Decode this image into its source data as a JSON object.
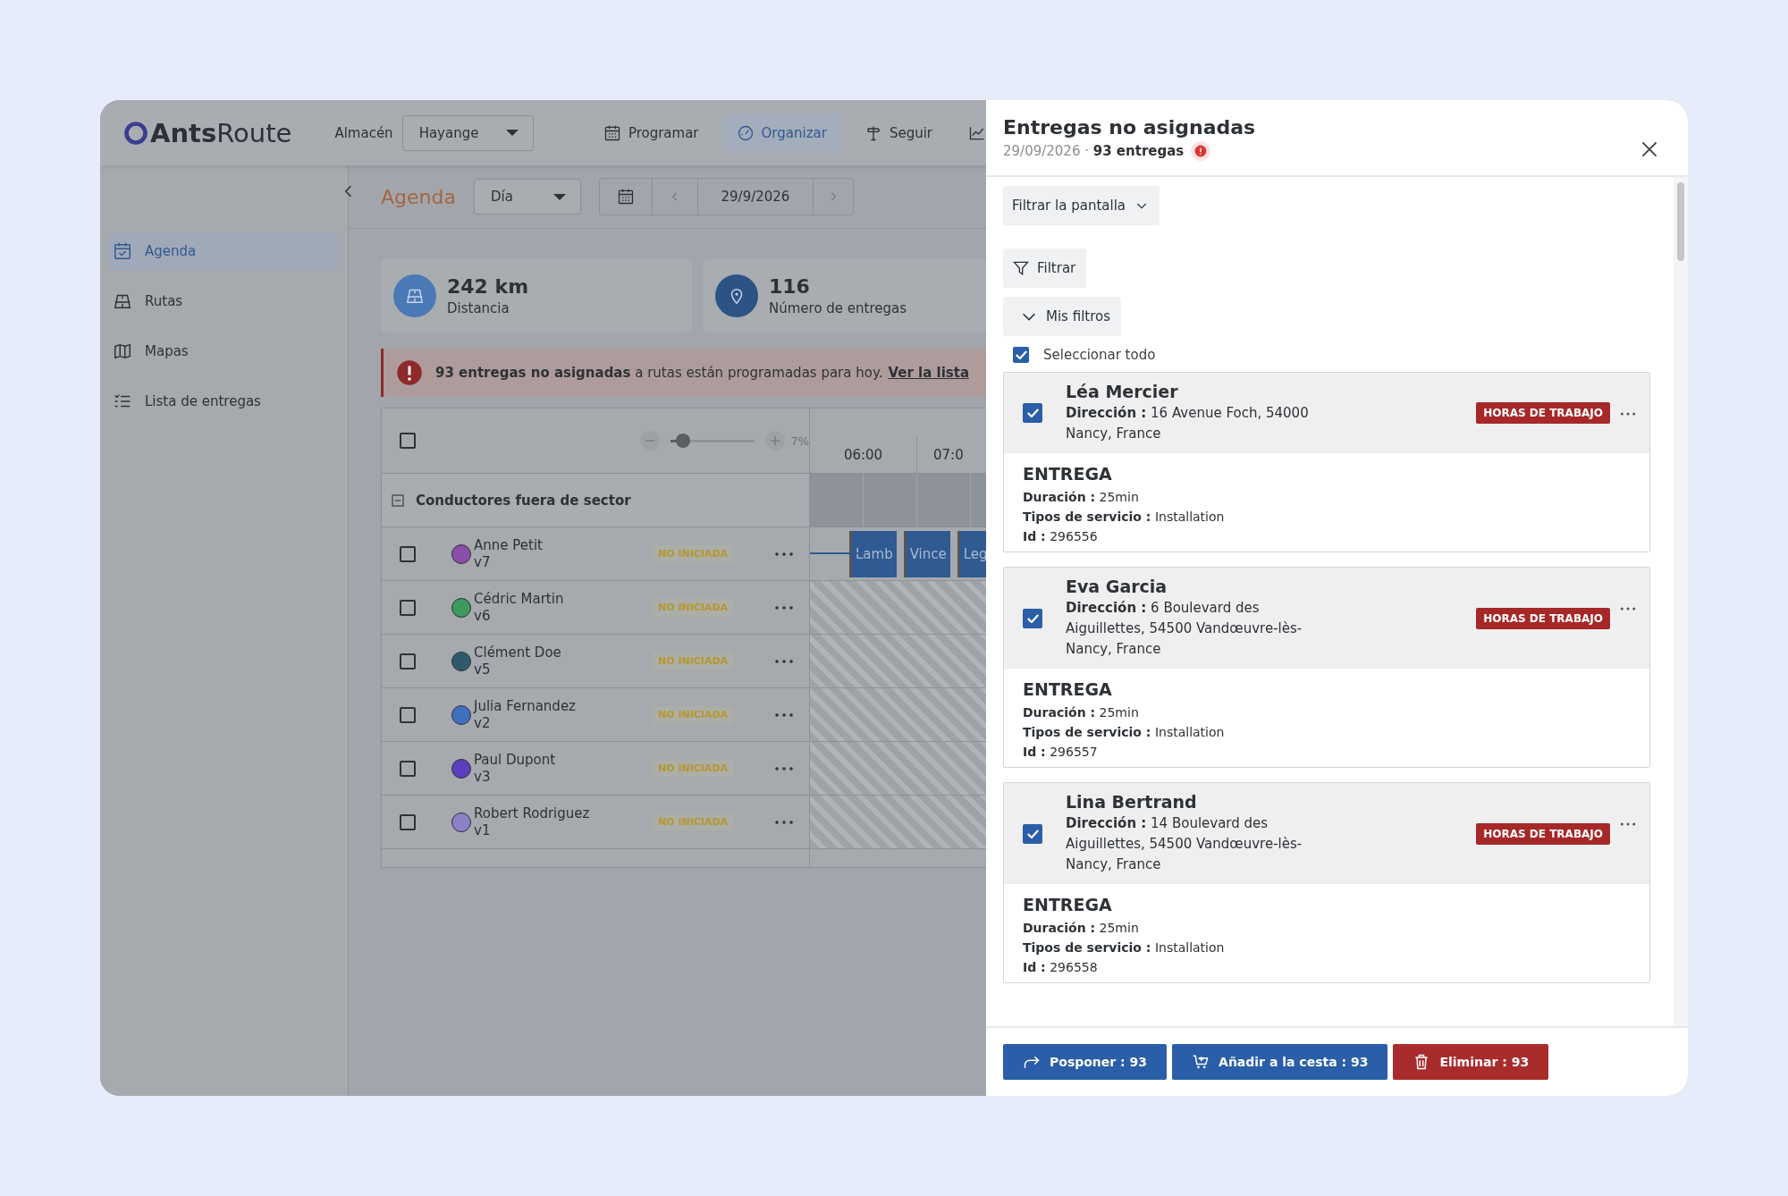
{
  "header": {
    "logo": "**Ants**Route",
    "warehouse_label": "Almacén",
    "warehouse": "Hayange",
    "nav": [
      {
        "label": "Programar",
        "selected": false
      },
      {
        "label": "Organizar",
        "selected": true
      },
      {
        "label": "Seguir",
        "selected": false
      }
    ]
  },
  "sidebar": {
    "items": [
      {
        "label": "Agenda",
        "selected": true
      },
      {
        "label": "Rutas",
        "selected": false
      },
      {
        "label": "Mapas",
        "selected": false
      },
      {
        "label": "Lista de entregas",
        "selected": false
      }
    ]
  },
  "toolbar": {
    "title": "Agenda",
    "view": "Día",
    "date": "29/9/2026"
  },
  "stats": [
    {
      "value": "242 km",
      "label": "Distancia"
    },
    {
      "value": "116",
      "label": "Número de entregas"
    }
  ],
  "alert": {
    "text": "**93 entregas no asignadas** a rutas están programadas para hoy.",
    "link": "Ver la lista"
  },
  "table": {
    "select_all": {
      "checked": false
    },
    "zoom": {
      "level": 0.07,
      "reading": "7%"
    },
    "hours": [
      "06:00",
      "07:0"
    ],
    "group": {
      "label": "Conductores fuera de sector",
      "expanded": true
    },
    "drivers": [
      {
        "name": "Anne Petit",
        "vehicle": "v7",
        "color": "#8a4ea8",
        "status": "NO INICIADA",
        "checked": false,
        "blocks": [
          "Lamb",
          "Vince",
          "Leg"
        ]
      },
      {
        "name": "Cédric Martin",
        "vehicle": "v6",
        "color": "#3d9a5e",
        "status": "NO INICIADA",
        "checked": false
      },
      {
        "name": "Clément Doe",
        "vehicle": "v5",
        "color": "#2f5a6c",
        "status": "NO INICIADA",
        "checked": false
      },
      {
        "name": "Julia Fernandez",
        "vehicle": "v2",
        "color": "#4071c0",
        "status": "NO INICIADA",
        "checked": false
      },
      {
        "name": "Paul Dupont",
        "vehicle": "v3",
        "color": "#5a3fbe",
        "status": "NO INICIADA",
        "checked": false
      },
      {
        "name": "Robert Rodriguez",
        "vehicle": "v1",
        "color": "#8c80c6",
        "status": "NO INICIADA",
        "checked": false
      }
    ]
  },
  "drawer": {
    "title": "Entregas no asignadas",
    "subtitle": "29/09/2026 · **93 entregas**",
    "screen_filter": "Filtrar la pantalla",
    "filter": "Filtrar",
    "my_filters": "Mis filtros",
    "select_all": {
      "label": "Seleccionar todo",
      "checked": true
    },
    "deliveries": [
      {
        "name": "Léa Mercier",
        "address": "**Dirección :** 16 Avenue Foch, 54000 Nancy, France",
        "tag": "HORAS DE TRABAJO",
        "checked": true,
        "type": "ENTREGA",
        "details": [
          "**Duración :** 25min",
          "**Tipos de servicio :** Installation",
          "**Id :** 296556"
        ]
      },
      {
        "name": "Eva Garcia",
        "address": "**Dirección :** 6 Boulevard des Aiguillettes, 54500 Vandœuvre-lès-Nancy, France",
        "tag": "HORAS DE TRABAJO",
        "checked": true,
        "type": "ENTREGA",
        "details": [
          "**Duración :** 25min",
          "**Tipos de servicio :** Installation",
          "**Id :** 296557"
        ]
      },
      {
        "name": "Lina Bertrand",
        "address": "**Dirección :** 14 Boulevard des Aiguillettes, 54500 Vandœuvre-lès-Nancy, France",
        "tag": "HORAS DE TRABAJO",
        "checked": true,
        "type": "ENTREGA",
        "details": [
          "**Duración :** 25min",
          "**Tipos de servicio :** Installation",
          "**Id :** 296558"
        ]
      }
    ],
    "actions": [
      {
        "label": "Posponer : 93",
        "kind": "postpone"
      },
      {
        "label": "Añadir a la cesta : 93",
        "kind": "cart"
      },
      {
        "label": "Eliminar : 93",
        "kind": "delete"
      }
    ]
  }
}
